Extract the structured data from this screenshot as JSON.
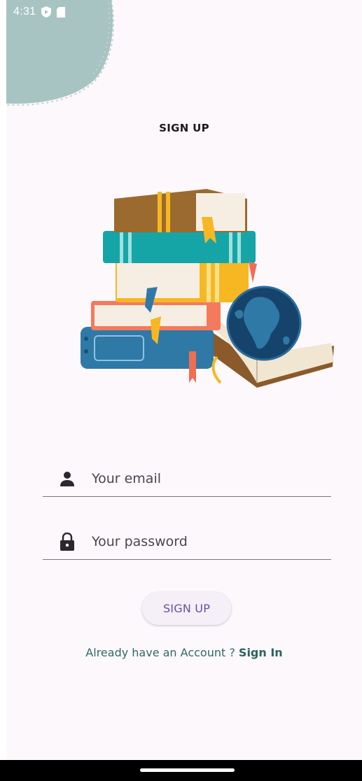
{
  "status_bar": {
    "time": "4:31"
  },
  "header": {
    "title": "SIGN UP"
  },
  "form": {
    "email_placeholder": "Your email",
    "password_placeholder": "Your password",
    "submit_label": "SIGN UP"
  },
  "footer": {
    "prompt": "Already have an Account ? ",
    "link_label": "Sign In"
  },
  "colors": {
    "background": "#fdf8fc",
    "accent_blob": "#a8c4c2",
    "button_text": "#6750a4",
    "link_text": "#2b6360"
  },
  "icons": [
    "shield-icon",
    "sd-card-icon",
    "person-icon",
    "lock-icon"
  ]
}
